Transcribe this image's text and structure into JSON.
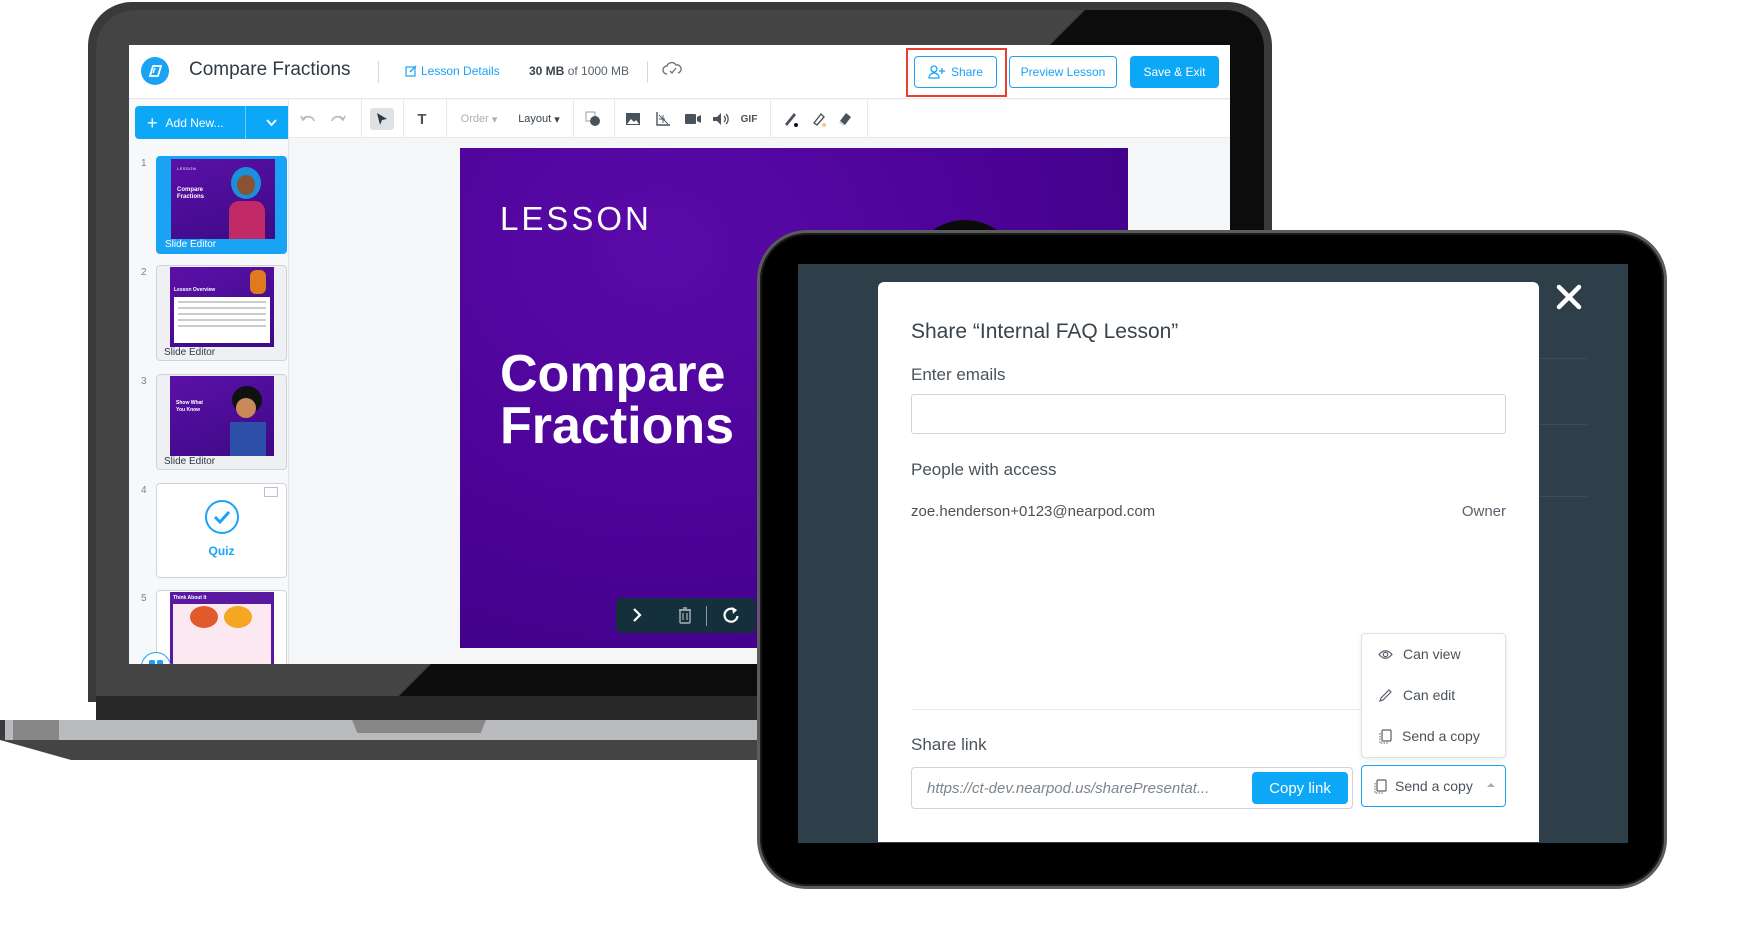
{
  "editor": {
    "title": "Compare Fractions",
    "lesson_details_label": "Lesson Details",
    "storage": {
      "used": "30 MB",
      "of_label": "of 1000 MB"
    },
    "share_label": "Share",
    "preview_label": "Preview Lesson",
    "save_exit_label": "Save & Exit",
    "add_new_label": "Add New...",
    "toolbar": {
      "order_label": "Order",
      "layout_label": "Layout",
      "gif_label": "GIF"
    },
    "slides": [
      {
        "number": "1",
        "caption": "Slide Editor",
        "mini_kicker": "LESSON",
        "mini_title": "Compare Fractions",
        "active": true
      },
      {
        "number": "2",
        "caption": "Slide Editor",
        "mini_title": "Lesson Overview"
      },
      {
        "number": "3",
        "caption": "Slide Editor",
        "mini_title": "Show What You Know"
      },
      {
        "number": "4",
        "caption": "Quiz"
      },
      {
        "number": "5",
        "mini_title": "Think About It"
      }
    ],
    "current_slide": {
      "kicker": "LESSON",
      "headline_line1": "Compare",
      "headline_line2": "Fractions"
    }
  },
  "share_dialog": {
    "title": "Share “Internal FAQ Lesson”",
    "emails_label": "Enter emails",
    "emails_value": "",
    "emails_placeholder": "",
    "people_label": "People with access",
    "people": [
      {
        "email": "zoe.henderson+0123@nearpod.com",
        "role": "Owner"
      }
    ],
    "share_link_label": "Share link",
    "share_link_value": "https://ct-dev.nearpod.us/sharePresentat...",
    "copy_link_label": "Copy link",
    "permission_selected": "Send a copy",
    "permission_options": [
      {
        "label": "Can view",
        "icon": "eye-icon"
      },
      {
        "label": "Can edit",
        "icon": "pencil-icon"
      },
      {
        "label": "Send a copy",
        "icon": "copy-icon"
      }
    ]
  },
  "colors": {
    "accent": "#0ca8f7",
    "highlight": "#e8402e",
    "slide_purple": "#4a0296",
    "overlay": "#2e3f4a"
  }
}
